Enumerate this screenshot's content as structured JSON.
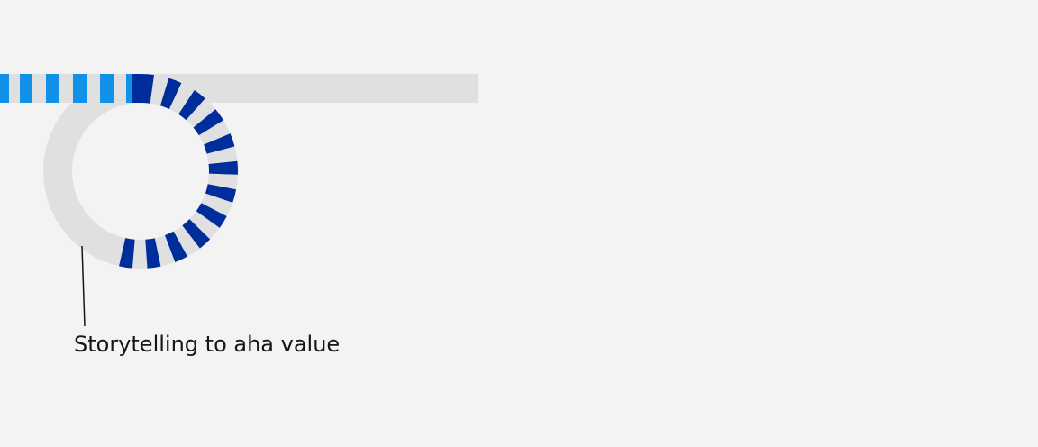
{
  "diagram": {
    "colors": {
      "background": "#f3f3f3",
      "track": "#e0e0e0",
      "light_dash": "#1192e8",
      "dark_dash": "#002d9c",
      "leader_line": "#161616",
      "label": "#161616"
    },
    "loop_progress": 0.55,
    "label": "Storytelling to aha value"
  }
}
